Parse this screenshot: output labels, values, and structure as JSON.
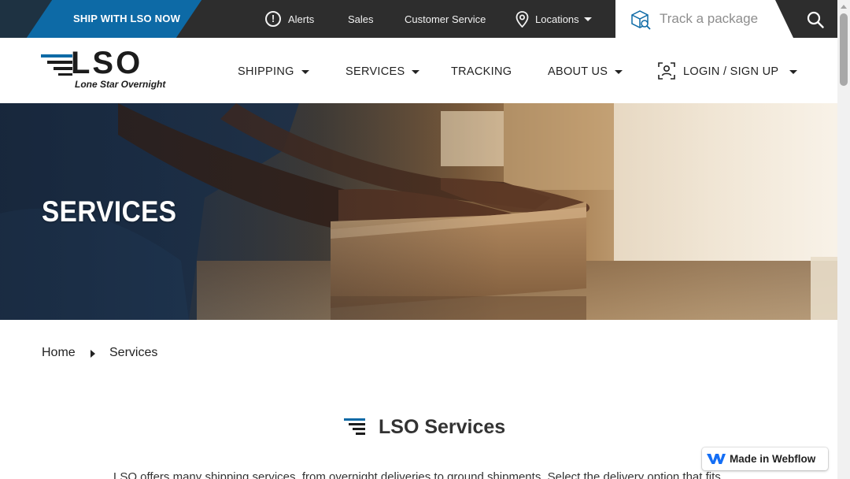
{
  "topbar": {
    "ship_cta": "SHIP WITH LSO NOW",
    "alerts": "Alerts",
    "sales": "Sales",
    "customer_service": "Customer Service",
    "locations": "Locations",
    "track_placeholder": "Track a package"
  },
  "logo": {
    "wordmark": "LSO",
    "tagline": "Lone Star Overnight"
  },
  "nav": {
    "shipping": "SHIPPING",
    "services": "SERVICES",
    "tracking": "TRACKING",
    "about": "ABOUT US",
    "login": "LOGIN / SIGN UP"
  },
  "hero": {
    "title": "SERVICES"
  },
  "breadcrumb": {
    "home": "Home",
    "current": "Services"
  },
  "section": {
    "title": "LSO Services",
    "intro": "LSO offers many shipping services, from overnight deliveries to ground shipments. Select the delivery option that fits"
  },
  "badge": {
    "label": "Made in Webflow"
  },
  "colors": {
    "accent_blue": "#0d6aa6",
    "dark_bar": "#2d2d2d"
  },
  "icons": [
    "alert-icon",
    "location-pin-icon",
    "package-search-icon",
    "search-icon",
    "user-scan-icon",
    "lso-stripes-icon",
    "webflow-icon"
  ]
}
